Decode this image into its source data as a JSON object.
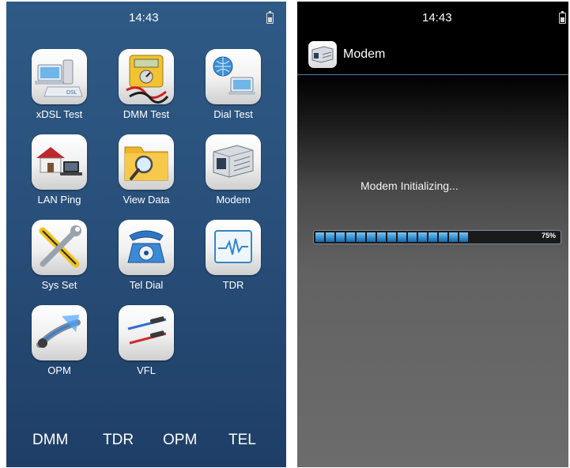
{
  "launcher": {
    "status_time": "14:43",
    "apps": [
      {
        "label": "xDSL Test",
        "icon": "xdsl-icon",
        "sub": "DSL"
      },
      {
        "label": "DMM Test",
        "icon": "dmm-icon"
      },
      {
        "label": "Dial Test",
        "icon": "dial-test-icon"
      },
      {
        "label": "LAN Ping",
        "icon": "lan-ping-icon"
      },
      {
        "label": "View Data",
        "icon": "folder-icon"
      },
      {
        "label": "Modem",
        "icon": "modem-icon"
      },
      {
        "label": "Sys Set",
        "icon": "tools-icon"
      },
      {
        "label": "Tel Dial",
        "icon": "telephone-icon"
      },
      {
        "label": "TDR",
        "icon": "tdr-waveform-icon"
      },
      {
        "label": "OPM",
        "icon": "opm-icon"
      },
      {
        "label": "VFL",
        "icon": "vfl-icon"
      }
    ],
    "dock": [
      "DMM",
      "TDR",
      "OPM",
      "TEL"
    ]
  },
  "modem_screen": {
    "status_time": "14:43",
    "title": "Modem",
    "title_icon": "modem-icon",
    "message": "Modem Initializing...",
    "progress_text": "75%",
    "progress_value": 0.75,
    "progress_segments": 15
  },
  "colors": {
    "launcher_bg": "#2c5580",
    "accent_blue": "#2f8ed0",
    "divider": "#5b7f9e"
  }
}
